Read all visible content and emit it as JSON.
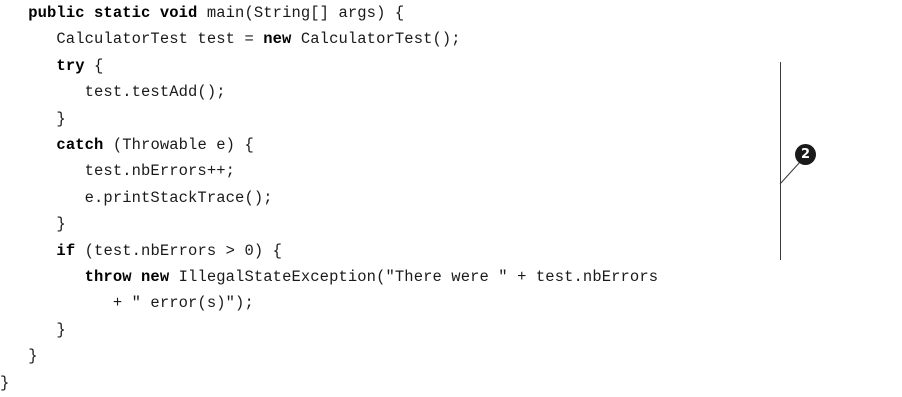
{
  "code": {
    "lines": [
      [
        {
          "t": "   "
        },
        {
          "t": "public static void",
          "kw": true
        },
        {
          "t": " main(String[] args) {"
        }
      ],
      [
        {
          "t": "      CalculatorTest test = "
        },
        {
          "t": "new",
          "kw": true
        },
        {
          "t": " CalculatorTest();"
        }
      ],
      [
        {
          "t": "      "
        },
        {
          "t": "try",
          "kw": true
        },
        {
          "t": " {"
        }
      ],
      [
        {
          "t": "         test.testAdd();"
        }
      ],
      [
        {
          "t": "      }"
        }
      ],
      [
        {
          "t": "      "
        },
        {
          "t": "catch",
          "kw": true
        },
        {
          "t": " (Throwable e) {"
        }
      ],
      [
        {
          "t": "         test.nbErrors++;"
        }
      ],
      [
        {
          "t": "         e.printStackTrace();"
        }
      ],
      [
        {
          "t": "      }"
        }
      ],
      [
        {
          "t": "      "
        },
        {
          "t": "if",
          "kw": true
        },
        {
          "t": " (test.nbErrors > 0) {"
        }
      ],
      [
        {
          "t": "         "
        },
        {
          "t": "throw new",
          "kw": true
        },
        {
          "t": " IllegalStateException(\"There were \" + test.nbErrors"
        }
      ],
      [
        {
          "t": "            + \" error(s)\");"
        }
      ],
      [
        {
          "t": "      }"
        }
      ],
      [
        {
          "t": "   }"
        }
      ],
      [
        {
          "t": "}"
        }
      ]
    ]
  },
  "callout": {
    "number": "2"
  }
}
